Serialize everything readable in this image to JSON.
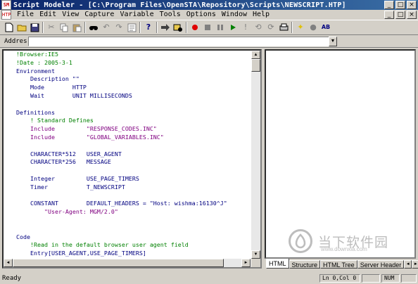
{
  "titlebar": {
    "icon_label": "SM",
    "title": "Script Modeler - [C:\\Program Files\\OpenSTA\\Repository\\Scripts\\NEWSCRIPT.HTP]",
    "minimize": "_",
    "maximize": "□",
    "close": "×"
  },
  "menu": {
    "icon_label": "HTP",
    "items": [
      "File",
      "Edit",
      "View",
      "Capture",
      "Variable",
      "Tools",
      "Options",
      "Window",
      "Help"
    ]
  },
  "toolbar": {
    "icons": [
      "new-document-icon",
      "open-folder-icon",
      "save-icon",
      "cut-icon",
      "copy-icon",
      "paste-icon",
      "find-icon",
      "undo-icon",
      "redo-icon",
      "compile-icon",
      "help-icon",
      "go-icon",
      "capture-icon",
      "record-icon",
      "stop-icon",
      "pause-icon",
      "play-icon",
      "insert-cursor-icon",
      "replace-icon",
      "sync-icon",
      "print-icon",
      "highlight-icon",
      "dot-icon",
      "check-icon"
    ]
  },
  "address": {
    "label": "Addres:",
    "value": ""
  },
  "editor": {
    "lines": [
      {
        "text": "!Browser:IE5",
        "color": "#008000"
      },
      {
        "text": "!Date : 2005-3-1",
        "color": "#008000"
      },
      {
        "text": "Environment",
        "color": "#000080"
      },
      {
        "text": "    Description \"\"",
        "color": "#000080"
      },
      {
        "text": "    Mode        HTTP",
        "color": "#000080"
      },
      {
        "text": "    Wait        UNIT MILLISECONDS",
        "color": "#000080"
      },
      {
        "text": "",
        "color": "#000000"
      },
      {
        "text": "Definitions",
        "color": "#000080"
      },
      {
        "text": "    ! Standard Defines",
        "color": "#008000"
      },
      {
        "text": "    Include         \"RESPONSE_CODES.INC\"",
        "color": "#800080"
      },
      {
        "text": "    Include         \"GLOBAL_VARIABLES.INC\"",
        "color": "#800080"
      },
      {
        "text": "",
        "color": "#000000"
      },
      {
        "text": "    CHARACTER*512   USER_AGENT",
        "color": "#000080"
      },
      {
        "text": "    CHARACTER*256   MESSAGE",
        "color": "#000080"
      },
      {
        "text": "",
        "color": "#000000"
      },
      {
        "text": "    Integer         USE_PAGE_TIMERS",
        "color": "#000080"
      },
      {
        "text": "    Timer           T_NEWSCRIPT",
        "color": "#000080"
      },
      {
        "text": "",
        "color": "#000000"
      },
      {
        "text": "    CONSTANT        DEFAULT_HEADERS = \"Host: wishma:16130^J\"",
        "color": "#000080"
      },
      {
        "text": "        \"User-Agent: MGM/2.0\"",
        "color": "#800080"
      },
      {
        "text": "",
        "color": "#000000"
      },
      {
        "text": "",
        "color": "#000000"
      },
      {
        "text": "Code",
        "color": "#000080"
      },
      {
        "text": "    !Read in the default browser user agent field",
        "color": "#008000"
      },
      {
        "text": "    Entry[USER_AGENT,USE_PAGE_TIMERS]",
        "color": "#000080"
      }
    ]
  },
  "tabs": [
    "HTML",
    "Structure",
    "HTML Tree",
    "Server Header"
  ],
  "tab_arrows": [
    "◄",
    "►"
  ],
  "status": {
    "text": "Ready",
    "position": "Ln 0,Col 0",
    "num": "NUM"
  },
  "watermark": {
    "text": "当下软件园",
    "sub": "www.downxia.com"
  }
}
